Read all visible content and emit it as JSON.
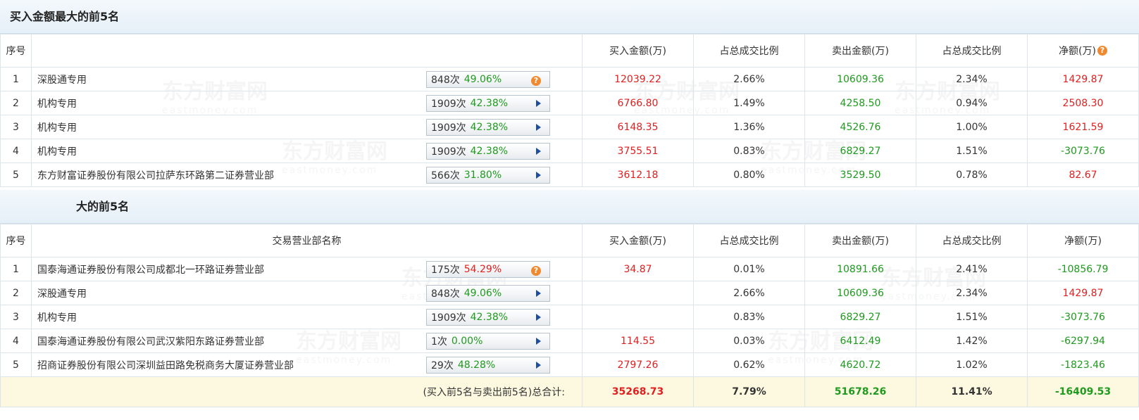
{
  "buy_section": {
    "title": "买入金额最大的前5名",
    "headers": {
      "seq": "序号",
      "name": "",
      "buy": "买入金额(万)",
      "buy_ratio": "占总成交比例",
      "sell": "卖出金额(万)",
      "sell_ratio": "占总成交比例",
      "net": "净额(万)"
    },
    "rows": [
      {
        "seq": "1",
        "name": "深股通专用",
        "count": "848次",
        "pct": "49.06%",
        "pct_color": "green",
        "icon": "help-icon",
        "buy": "12039.22",
        "buy_ratio": "2.66%",
        "sell": "10609.36",
        "sell_ratio": "2.34%",
        "net": "1429.87",
        "net_color": "red"
      },
      {
        "seq": "2",
        "name": "机构专用",
        "count": "1909次",
        "pct": "42.38%",
        "pct_color": "green",
        "icon": "arrow-icon",
        "buy": "6766.80",
        "buy_ratio": "1.49%",
        "sell": "4258.50",
        "sell_ratio": "0.94%",
        "net": "2508.30",
        "net_color": "red"
      },
      {
        "seq": "3",
        "name": "机构专用",
        "count": "1909次",
        "pct": "42.38%",
        "pct_color": "green",
        "icon": "arrow-icon",
        "buy": "6148.35",
        "buy_ratio": "1.36%",
        "sell": "4526.76",
        "sell_ratio": "1.00%",
        "net": "1621.59",
        "net_color": "red"
      },
      {
        "seq": "4",
        "name": "机构专用",
        "count": "1909次",
        "pct": "42.38%",
        "pct_color": "green",
        "icon": "arrow-icon",
        "buy": "3755.51",
        "buy_ratio": "0.83%",
        "sell": "6829.27",
        "sell_ratio": "1.51%",
        "net": "-3073.76",
        "net_color": "green"
      },
      {
        "seq": "5",
        "name": "东方财富证券股份有限公司拉萨东环路第二证券营业部",
        "count": "566次",
        "pct": "31.80%",
        "pct_color": "green",
        "icon": "arrow-icon",
        "buy": "3612.18",
        "buy_ratio": "0.80%",
        "sell": "3529.50",
        "sell_ratio": "0.78%",
        "net": "82.67",
        "net_color": "red"
      }
    ]
  },
  "sell_section": {
    "title": "大的前5名",
    "headers": {
      "seq": "序号",
      "name": "交易营业部名称",
      "buy": "买入金额(万)",
      "buy_ratio": "占总成交比例",
      "sell": "卖出金额(万)",
      "sell_ratio": "占总成交比例",
      "net": "净额(万)"
    },
    "rows": [
      {
        "seq": "1",
        "name": "国泰海通证券股份有限公司成都北一环路证券营业部",
        "count": "175次",
        "pct": "54.29%",
        "pct_color": "red",
        "icon": "help-icon",
        "buy": "34.87",
        "buy_ratio": "0.01%",
        "sell": "10891.66",
        "sell_ratio": "2.41%",
        "net": "-10856.79",
        "net_color": "green"
      },
      {
        "seq": "2",
        "name": "深股通专用",
        "count": "848次",
        "pct": "49.06%",
        "pct_color": "green",
        "icon": "arrow-icon",
        "buy": "",
        "buy_ratio": "2.66%",
        "sell": "10609.36",
        "sell_ratio": "2.34%",
        "net": "1429.87",
        "net_color": "red"
      },
      {
        "seq": "3",
        "name": "机构专用",
        "count": "1909次",
        "pct": "42.38%",
        "pct_color": "green",
        "icon": "arrow-icon",
        "buy": "",
        "buy_ratio": "0.83%",
        "sell": "6829.27",
        "sell_ratio": "1.51%",
        "net": "-3073.76",
        "net_color": "green"
      },
      {
        "seq": "4",
        "name": "国泰海通证券股份有限公司武汉紫阳东路证券营业部",
        "count": "1次",
        "pct": "0.00%",
        "pct_color": "green",
        "icon": "arrow-icon",
        "buy": "114.55",
        "buy_ratio": "0.03%",
        "sell": "6412.49",
        "sell_ratio": "1.42%",
        "net": "-6297.94",
        "net_color": "green"
      },
      {
        "seq": "5",
        "name": "招商证券股份有限公司深圳益田路免税商务大厦证券营业部",
        "count": "29次",
        "pct": "48.28%",
        "pct_color": "green",
        "icon": "arrow-icon",
        "buy": "2797.26",
        "buy_ratio": "0.62%",
        "sell": "4620.72",
        "sell_ratio": "1.02%",
        "net": "-1823.46",
        "net_color": "green"
      }
    ]
  },
  "total": {
    "label": "(买入前5名与卖出前5名)总合计:",
    "buy": "35268.73",
    "buy_ratio": "7.79%",
    "sell": "51678.26",
    "sell_ratio": "11.41%",
    "net": "-16409.53"
  },
  "watermark": {
    "cn": "东方财富网",
    "en": "eastmoney.com"
  },
  "colors": {
    "red": "#e02020",
    "green": "#1e9a1e",
    "header_bg": "#e6f0f8",
    "total_bg": "#fdf9e0",
    "help_icon": "#f08a30",
    "arrow_icon": "#1e4e9c"
  }
}
